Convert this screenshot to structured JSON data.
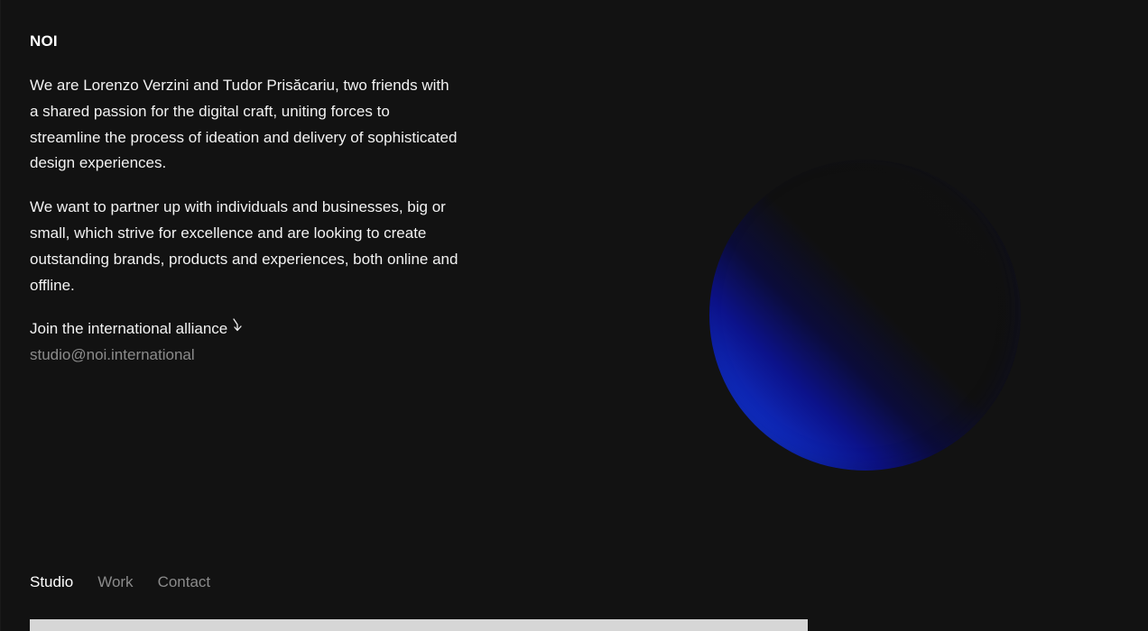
{
  "brand": {
    "logo_text": "NOI"
  },
  "intro": {
    "paragraph_1": "We are Lorenzo Verzini and Tudor Prisăcariu, two friends with a shared passion for the digital craft, uniting forces to streamline the process of ideation and delivery of sophisticated design experiences.",
    "paragraph_2": "We want to partner up with individuals and businesses, big or small, which strive for excellence and are looking to create outstanding brands, products and experiences, both online and offline."
  },
  "cta": {
    "join_label": "Join the international alliance",
    "arrow_icon": "arrow-down-right",
    "email": "studio@noi.international"
  },
  "nav": {
    "items": [
      {
        "label": "Studio",
        "active": true
      },
      {
        "label": "Work",
        "active": false
      },
      {
        "label": "Contact",
        "active": false
      }
    ]
  },
  "colors": {
    "background": "#121212",
    "text": "#f2f2f2",
    "muted": "#8b8b8b",
    "orb_blue": "#0f2fc6"
  }
}
